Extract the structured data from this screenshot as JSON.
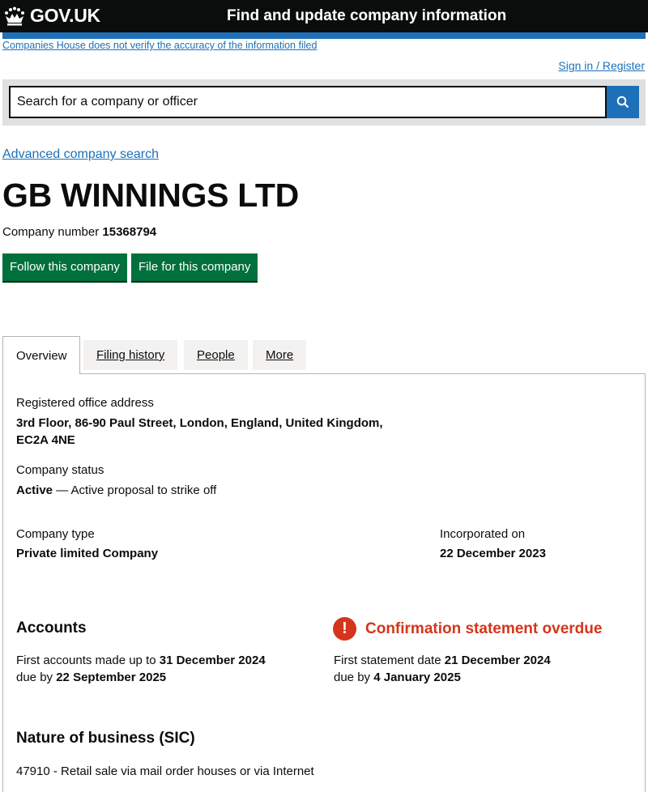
{
  "header": {
    "logo_text": "GOV.UK",
    "service_name": "Find and update company information",
    "accent_color": "#1d70b8"
  },
  "disclaimer_link": "Companies House does not verify the accuracy of the information filed",
  "signin_link": "Sign in / Register",
  "search": {
    "placeholder": "Search for a company or officer",
    "button_icon": "search-icon"
  },
  "advanced_search_link": "Advanced company search",
  "company": {
    "name": "GB WINNINGS LTD",
    "number_label": "Company number",
    "number": "15368794"
  },
  "actions": {
    "follow_label": "Follow this company",
    "file_label": "File for this company"
  },
  "tabs": [
    {
      "label": "Overview",
      "active": true
    },
    {
      "label": "Filing history",
      "active": false
    },
    {
      "label": "People",
      "active": false
    },
    {
      "label": "More",
      "active": false
    }
  ],
  "overview": {
    "address_label": "Registered office address",
    "address_line1": "3rd Floor, 86-90 Paul Street, London, England, United Kingdom,",
    "address_line2": "EC2A 4NE",
    "status_label": "Company status",
    "status_value": "Active",
    "status_detail": " — Active proposal to strike off",
    "type_label": "Company type",
    "type_value": "Private limited Company",
    "incorporated_label": "Incorporated on",
    "incorporated_value": "22 December 2023"
  },
  "accounts": {
    "heading": "Accounts",
    "first_made_up_prefix": "First accounts made up to ",
    "first_made_up_date": "31 December 2024",
    "due_prefix": "due by ",
    "due_date": "22 September 2025"
  },
  "confirmation": {
    "warning_icon": "exclamation-icon",
    "heading": "Confirmation statement overdue",
    "first_statement_prefix": "First statement date ",
    "first_statement_date": "21 December 2024",
    "due_prefix": "due by ",
    "due_date": "4 January 2025",
    "color": "#d4351c"
  },
  "sic": {
    "heading": "Nature of business (SIC)",
    "item": "47910 - Retail sale via mail order houses or via Internet"
  }
}
